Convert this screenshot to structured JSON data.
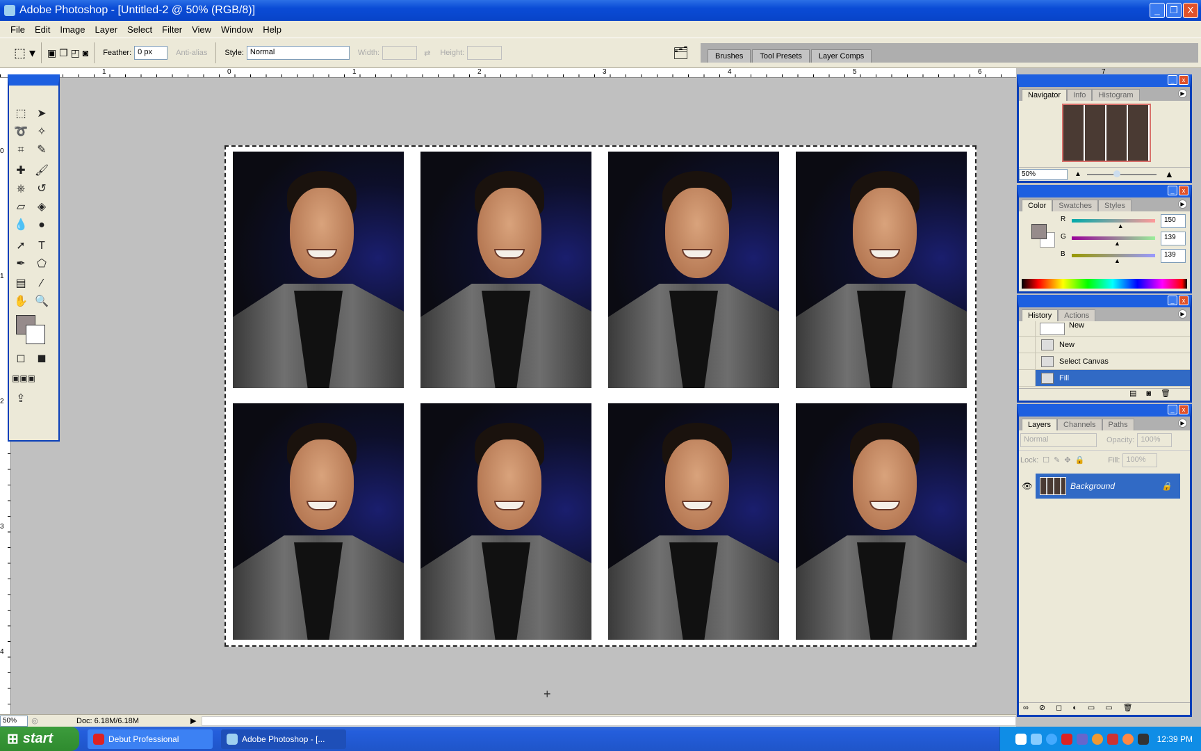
{
  "window": {
    "title": "Adobe Photoshop - [Untitled-2 @ 50% (RGB/8)]",
    "minimize": "_",
    "restore": "❐",
    "close": "X"
  },
  "menu": [
    "File",
    "Edit",
    "Image",
    "Layer",
    "Select",
    "Filter",
    "View",
    "Window",
    "Help"
  ],
  "options": {
    "feather_label": "Feather:",
    "feather_value": "0 px",
    "antialias_label": "Anti-alias",
    "style_label": "Style:",
    "style_value": "Normal",
    "width_label": "Width:",
    "height_label": "Height:"
  },
  "palette_well": [
    "Brushes",
    "Tool Presets",
    "Layer Comps"
  ],
  "ruler_top": [
    "1",
    "0",
    "1",
    "2",
    "3",
    "4",
    "5",
    "6",
    "7"
  ],
  "ruler_left": [
    "0",
    "1",
    "2",
    "3",
    "4"
  ],
  "navigator": {
    "tabs": [
      "Navigator",
      "Info",
      "Histogram"
    ],
    "zoom": "50%"
  },
  "color": {
    "tabs": [
      "Color",
      "Swatches",
      "Styles"
    ],
    "foreground": "#968b8b",
    "channels": [
      {
        "label": "R",
        "value": "150",
        "fraction": 0.59
      },
      {
        "label": "G",
        "value": "139",
        "fraction": 0.55
      },
      {
        "label": "B",
        "value": "139",
        "fraction": 0.55
      }
    ]
  },
  "history": {
    "tabs": [
      "History",
      "Actions"
    ],
    "snapshot": "New",
    "items": [
      "New",
      "Select Canvas",
      "Fill"
    ],
    "selected": "Fill"
  },
  "layers": {
    "tabs": [
      "Layers",
      "Channels",
      "Paths"
    ],
    "blend": "Normal",
    "opacity_label": "Opacity:",
    "opacity": "100%",
    "lock_label": "Lock:",
    "fill_label": "Fill:",
    "fill": "100%",
    "items": [
      {
        "name": "Background",
        "visible": true,
        "locked": true
      }
    ]
  },
  "status": {
    "zoom": "50%",
    "doc": "Doc: 6.18M/6.18M"
  },
  "taskbar": {
    "start": "start",
    "tasks": [
      "Debut Professional",
      "Adobe Photoshop - [..."
    ],
    "clock": "12:39 PM"
  }
}
